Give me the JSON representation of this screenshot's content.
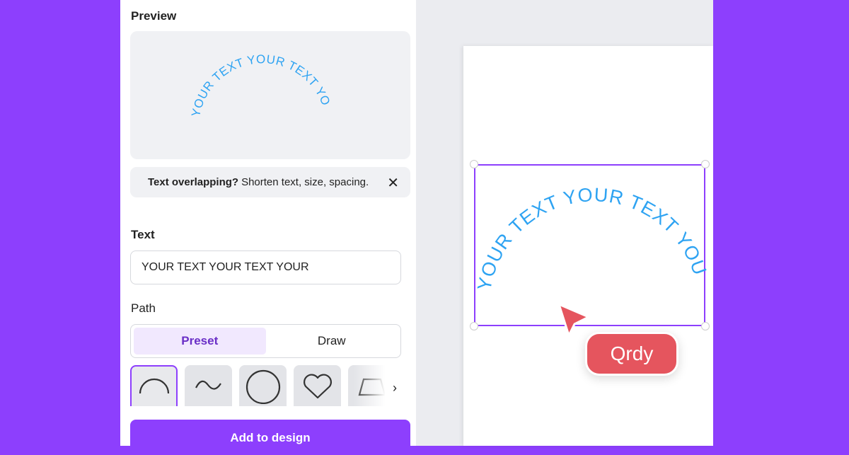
{
  "panel": {
    "preview_heading": "Preview",
    "curved_text": "YOUR TEXT YOUR TEXT YOUR",
    "notice": {
      "bold": "Text overlapping?",
      "rest": "Shorten text, size, spacing."
    },
    "text_heading": "Text",
    "text_value": "YOUR TEXT YOUR TEXT YOUR",
    "path_heading": "Path",
    "tabs": [
      {
        "label": "Preset",
        "active": true
      },
      {
        "label": "Draw",
        "active": false
      }
    ],
    "shapes": [
      "arc-icon",
      "wave-icon",
      "circle-icon",
      "heart-icon",
      "trapezoid-icon"
    ],
    "add_button": "Add to design"
  },
  "canvas": {
    "curved_text": "YOUR TEXT YOUR TEXT YOUR",
    "cursor_label": "Qrdy"
  },
  "colors": {
    "accent": "#8d3ffd",
    "text_curve": "#2ea3f2",
    "cursor": "#e5555e"
  }
}
